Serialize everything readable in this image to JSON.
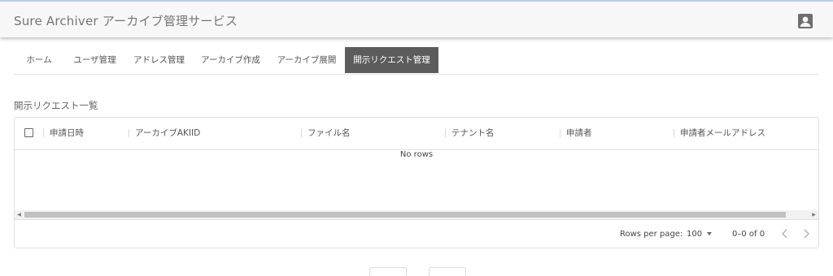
{
  "app": {
    "title": "Sure Archiver アーカイブ管理サービス",
    "account_icon": "account-box-icon"
  },
  "tabs": [
    {
      "label": "ホーム",
      "active": false
    },
    {
      "label": "ユーザ管理",
      "active": false
    },
    {
      "label": "アドレス管理",
      "active": false
    },
    {
      "label": "アーカイブ作成",
      "active": false
    },
    {
      "label": "アーカイブ展開",
      "active": false
    },
    {
      "label": "開示リクエスト管理",
      "active": true
    }
  ],
  "section": {
    "title": "開示リクエスト一覧"
  },
  "grid": {
    "columns": [
      "申請日時",
      "アーカイブAKIID",
      "ファイル名",
      "テナント名",
      "申請者",
      "申請者メールアドレス"
    ],
    "empty_text": "No rows",
    "rows": [],
    "footer": {
      "rows_per_page_label": "Rows per page:",
      "rows_per_page_value": "100",
      "page_range": "0–0 of 0"
    }
  },
  "colors": {
    "active_tab_bg": "#5c5c5c",
    "appbar_bg": "#f7f7f7",
    "appbar_top_border": "#b9cde6"
  }
}
